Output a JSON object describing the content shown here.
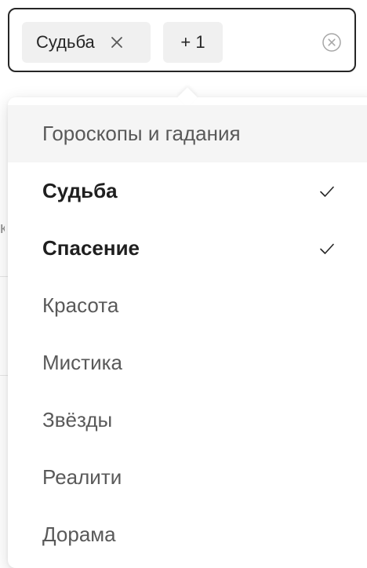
{
  "select": {
    "tags": [
      {
        "label": "Судьба",
        "remove_icon": "close-icon"
      },
      {
        "label": "+ 1"
      }
    ],
    "clear_icon": "close-circle-icon"
  },
  "dropdown": {
    "options": [
      {
        "label": "Гороскопы и гадания",
        "state": "active",
        "selected": false
      },
      {
        "label": "Судьба",
        "selected": true,
        "check_icon": "check-icon"
      },
      {
        "label": "Спасение",
        "selected": true,
        "check_icon": "check-icon"
      },
      {
        "label": "Красота",
        "selected": false
      },
      {
        "label": "Мистика",
        "selected": false
      },
      {
        "label": "Звёзды",
        "selected": false
      },
      {
        "label": "Реалити",
        "selected": false
      },
      {
        "label": "Дорама",
        "selected": false
      }
    ]
  },
  "colors": {
    "border": "#262626",
    "tag_bg": "#f0f0f0",
    "active_bg": "#f5f5f5",
    "muted_text": "#595959",
    "strong_text": "#1f1f1f"
  }
}
